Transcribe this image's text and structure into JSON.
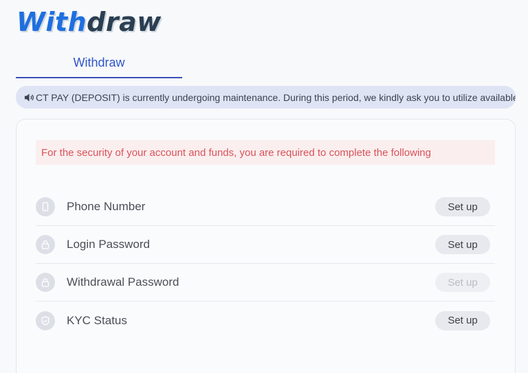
{
  "header": {
    "title_accent": "With",
    "title_rest": "draw"
  },
  "tabs": [
    {
      "label": "Withdraw",
      "active": true
    }
  ],
  "notice": {
    "text": "CT PAY (DEPOSIT) is currently undergoing maintenance. During this period, we kindly ask you to utilize available a"
  },
  "security": {
    "warning": "For the security of your account and funds, you are required to complete the following",
    "items": [
      {
        "label": "Phone Number",
        "icon": "phone-icon",
        "button": "Set up",
        "enabled": true
      },
      {
        "label": "Login Password",
        "icon": "lock-icon",
        "button": "Set up",
        "enabled": true
      },
      {
        "label": "Withdrawal Password",
        "icon": "lock-icon",
        "button": "Set up",
        "enabled": false
      },
      {
        "label": "KYC Status",
        "icon": "shield-check-icon",
        "button": "Set up",
        "enabled": true
      }
    ]
  },
  "colors": {
    "accent": "#2e55c7",
    "warning_text": "#d8535a",
    "warning_bg": "#fbeeee",
    "notice_bg": "#dfe4f5"
  }
}
